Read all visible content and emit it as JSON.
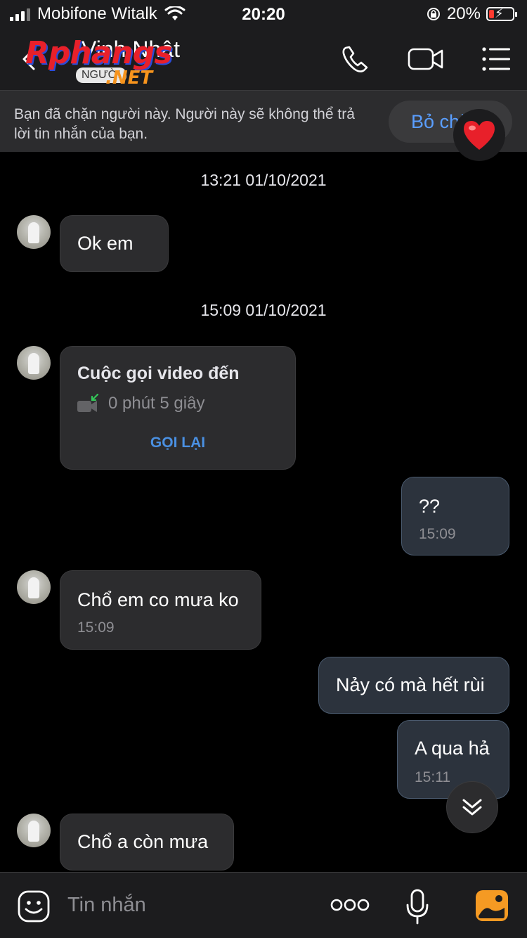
{
  "status_bar": {
    "carrier": "Mobifone Witalk",
    "time": "20:20",
    "battery": "20%"
  },
  "header": {
    "contact_name": "Vinh Nhật",
    "contact_sub": "NGƯỜI",
    "watermark_logo": "Rphangs",
    "watermark_net": ".NET",
    "icons": [
      "back-icon",
      "phone-icon",
      "video-camera-icon",
      "menu-list-icon"
    ]
  },
  "banner": {
    "text": "Bạn đã chặn người này. Người này sẽ không thể trả lời tin nhắn của bạn.",
    "button": "Bỏ chặn"
  },
  "messages": {
    "date1": "13:21 01/10/2021",
    "m1": {
      "text": "Ok em"
    },
    "date2": "15:09 01/10/2021",
    "call": {
      "title": "Cuộc gọi video đến",
      "duration": "0 phút 5 giây",
      "action": "GỌI LẠI"
    },
    "m2": {
      "text": "??",
      "time": "15:09"
    },
    "m3": {
      "text": "Chổ em co mưa ko",
      "time": "15:09"
    },
    "m4": {
      "text": "Nảy có mà hết rùi"
    },
    "m5": {
      "text": "A qua hả",
      "time": "15:11"
    },
    "m6": {
      "text": "Chổ a còn mưa"
    }
  },
  "input_bar": {
    "placeholder": "Tin nhắn"
  },
  "colors": {
    "background": "#000000",
    "incoming_bubble": "#2c2c2e",
    "outgoing_bubble": "#2c333d",
    "accent": "#4a90e2"
  }
}
